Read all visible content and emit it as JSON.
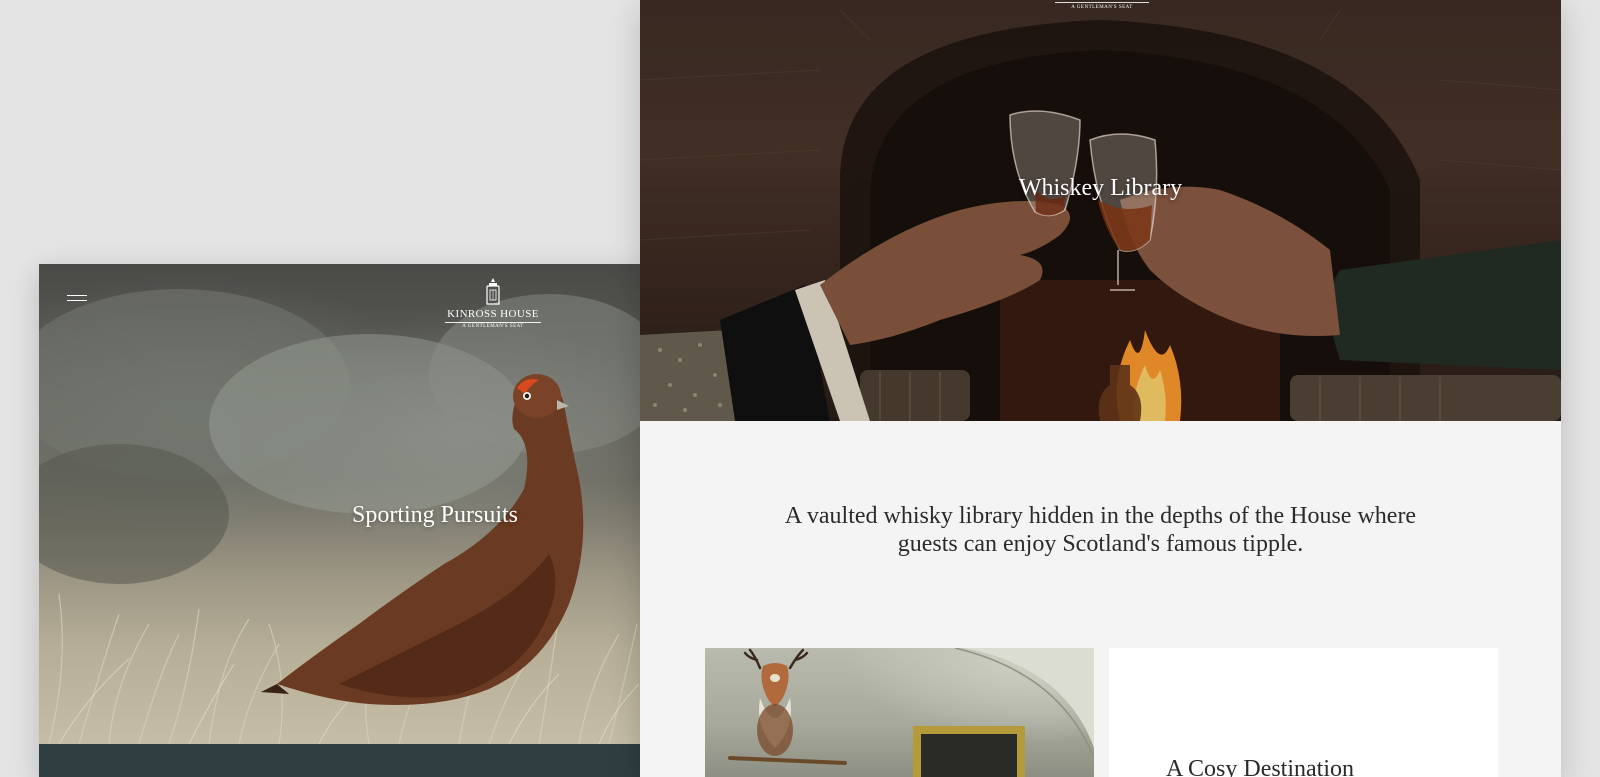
{
  "left_card": {
    "logo": {
      "name": "KINROSS HOUSE",
      "tagline": "A GENTLEMAN'S SEAT"
    },
    "title": "Sporting Pursuits",
    "footer_color": "#2f3e41"
  },
  "right_card": {
    "logo": {
      "tagline": "A GENTLEMAN'S SEAT"
    },
    "title": "Whiskey Library",
    "intro": "A vaulted whisky library hidden in the depths of the House where guests can enjoy Scotland's famous tipple.",
    "feature": {
      "heading": "A Cosy Destination"
    }
  },
  "icons": {
    "menu": "hamburger-menu-icon",
    "logo": "kinross-house-crest-icon"
  },
  "colors": {
    "background": "#e3e4e3",
    "panel": "#f4f4f4",
    "text": "#2b2b2b",
    "accent_dark": "#2f3e41"
  }
}
